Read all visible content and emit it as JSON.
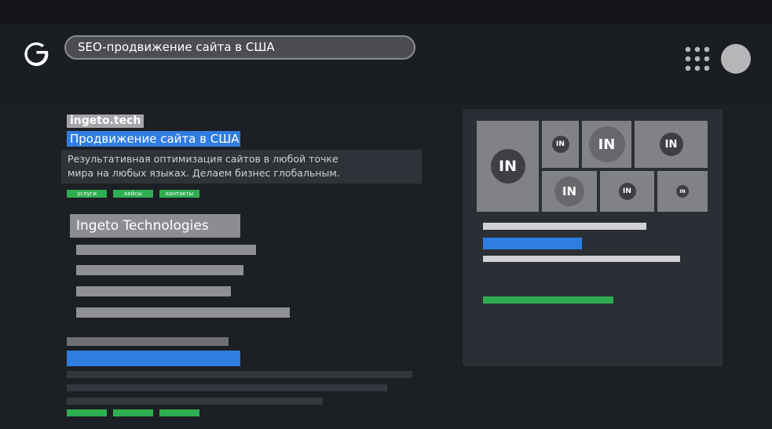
{
  "search": {
    "query": "SEO-продвижение сайта в США"
  },
  "result_ad": {
    "site": "ingeto.tech",
    "title": "Продвижение сайта в США",
    "description_lines": [
      "Результативная оптимизация сайтов в любой точке",
      "мира на любых языках. Делаем бизнес глобальным."
    ],
    "sitelinks": [
      "услуги",
      "кейсы",
      "контакты"
    ]
  },
  "organic": {
    "company": "Ingeto Technologies"
  },
  "knowledge_panel": {
    "logo_text": "IN"
  },
  "icons": {
    "logo": "google-g-icon",
    "apps": "apps-grid-icon",
    "account": "account-avatar"
  },
  "colors": {
    "accent_blue": "#2f7de0",
    "accent_green": "#2fae51"
  }
}
